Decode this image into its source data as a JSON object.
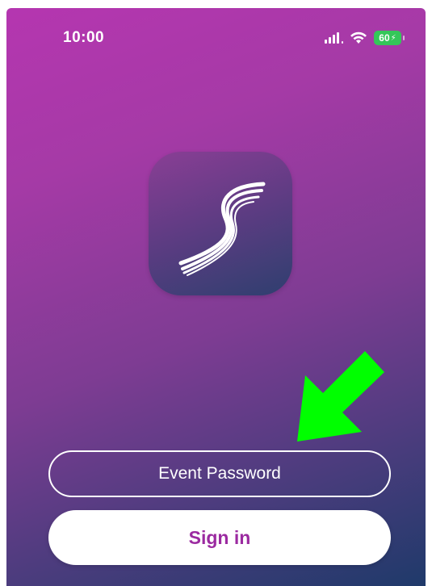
{
  "status_bar": {
    "time": "10:00",
    "battery": "60",
    "icons": [
      "signal-icon",
      "wifi-icon",
      "battery-charging-icon"
    ],
    "battery_color": "#34c759"
  },
  "logo": {
    "icon": "stylized-s-logo",
    "colors": [
      "#8a3e95",
      "#2f3f6f"
    ]
  },
  "annotation": {
    "icon": "green-arrow-icon",
    "color": "#00ff00"
  },
  "login": {
    "password_placeholder": "Event Password",
    "password_value": "",
    "signin_label": "Sign in"
  },
  "theme": {
    "gradient_top": "#b536b0",
    "gradient_bottom": "#1f3a6a",
    "accent": "#9b2aa0"
  }
}
